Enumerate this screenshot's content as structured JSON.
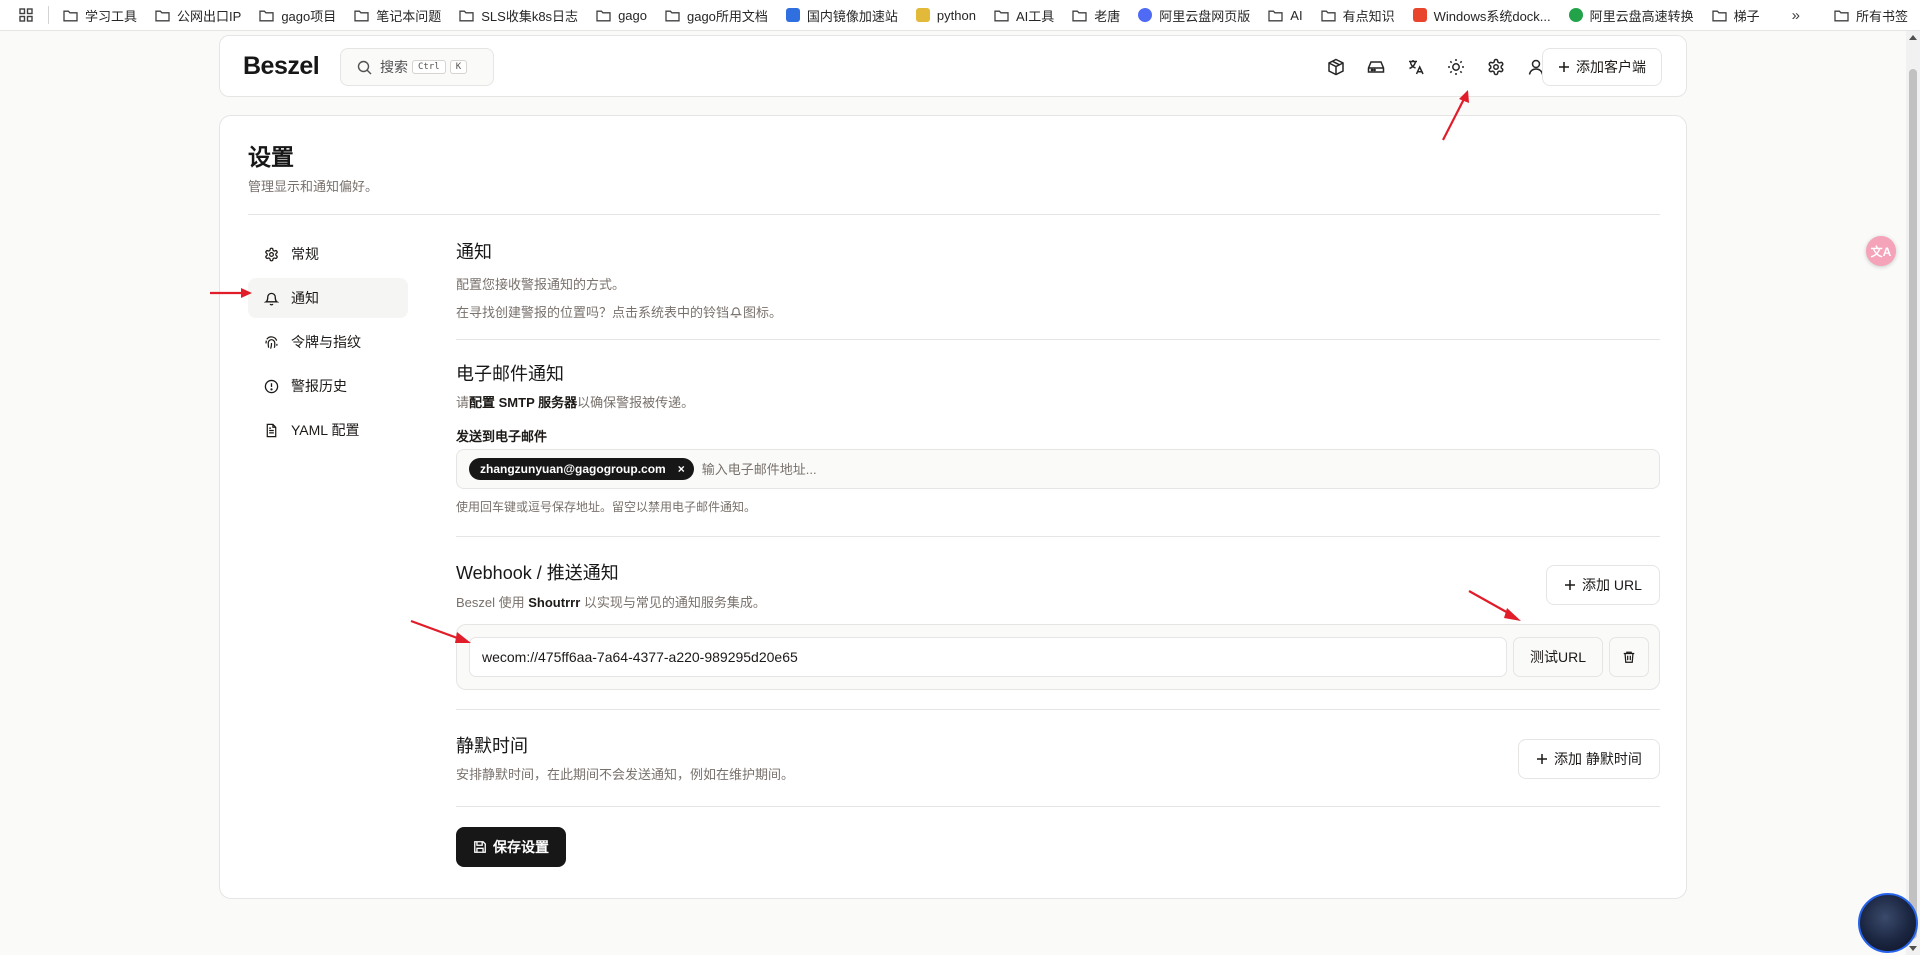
{
  "bookmarks": {
    "items": [
      {
        "label": "学习工具",
        "icon": "folder-icon"
      },
      {
        "label": "公网出口IP",
        "icon": "folder-icon"
      },
      {
        "label": "gago项目",
        "icon": "folder-icon"
      },
      {
        "label": "笔记本问题",
        "icon": "folder-icon"
      },
      {
        "label": "SLS收集k8s日志",
        "icon": "folder-icon"
      },
      {
        "label": "gago",
        "icon": "folder-icon"
      },
      {
        "label": "gago所用文档",
        "icon": "folder-icon"
      },
      {
        "label": "国内镜像加速站",
        "icon": "vscode-icon",
        "color": "#2f6fe0"
      },
      {
        "label": "python",
        "icon": "python-icon",
        "color": "#e3b93a"
      },
      {
        "label": "AI工具",
        "icon": "folder-icon"
      },
      {
        "label": "老唐",
        "icon": "folder-icon"
      },
      {
        "label": "阿里云盘网页版",
        "icon": "aliyun-icon",
        "color": "#4f6bf5"
      },
      {
        "label": "AI",
        "icon": "folder-icon"
      },
      {
        "label": "有点知识",
        "icon": "folder-icon"
      },
      {
        "label": "Windows系统dock...",
        "icon": "c-logo-icon",
        "color": "#e8452c"
      },
      {
        "label": "阿里云盘高速转换",
        "icon": "check-circle-icon",
        "color": "#22a34a"
      },
      {
        "label": "梯子",
        "icon": "folder-icon"
      }
    ],
    "more": "»",
    "all_bookmarks": "所有书签"
  },
  "header": {
    "logo": "Beszel",
    "search_label": "搜索",
    "search_kbd_1": "Ctrl",
    "search_kbd_2": "K",
    "add_client": "添加客户端"
  },
  "page": {
    "title": "设置",
    "subtitle": "管理显示和通知偏好。"
  },
  "sidenav": {
    "items": [
      {
        "label": "常规",
        "icon": "gear-icon"
      },
      {
        "label": "通知",
        "icon": "bell-icon",
        "active": true
      },
      {
        "label": "令牌与指纹",
        "icon": "fingerprint-icon"
      },
      {
        "label": "警报历史",
        "icon": "alert-circle-icon"
      },
      {
        "label": "YAML 配置",
        "icon": "file-text-icon"
      }
    ]
  },
  "notify": {
    "title": "通知",
    "desc": "配置您接收警报通知的方式。",
    "hint_pre": "在寻找创建警报的位置吗？点击系统表中的铃铛",
    "hint_post": "图标。"
  },
  "email": {
    "title": "电子邮件通知",
    "desc_pre": "请",
    "desc_link": "配置 SMTP 服务器",
    "desc_post": "以确保警报被传递。",
    "label": "发送到电子邮件",
    "chip": "zhangzunyuan@gagogroup.com",
    "chip_x": "×",
    "placeholder": "输入电子邮件地址...",
    "help": "使用回车键或逗号保存地址。留空以禁用电子邮件通知。"
  },
  "webhook": {
    "title": "Webhook / 推送通知",
    "desc_pre": "Beszel 使用 ",
    "desc_link": "Shoutrrr",
    "desc_post": " 以实现与常见的通知服务集成。",
    "add_url": "添加 URL",
    "url_value": "wecom://475ff6aa-7a64-4377-a220-989295d20e65",
    "test_url": "测试URL"
  },
  "quiet": {
    "title": "静默时间",
    "desc": "安排静默时间，在此期间不会发送通知，例如在维护期间。",
    "add": "添加 静默时间"
  },
  "save": "保存设置",
  "float": {
    "translate": "文A"
  },
  "colors": {
    "accent": "#171717",
    "border": "#e7e5e4",
    "muted": "#78716c",
    "annotation_arrow": "#e11d2a"
  }
}
